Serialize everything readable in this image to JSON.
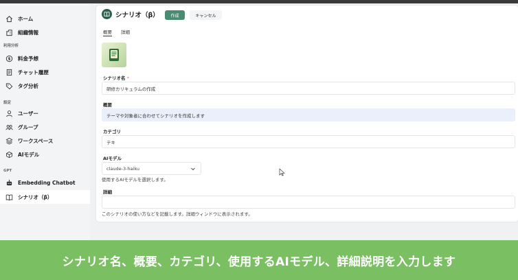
{
  "sidebar": {
    "top_items": [
      {
        "label": "ホーム",
        "icon": "home-icon"
      },
      {
        "label": "組織情報",
        "icon": "building-icon"
      }
    ],
    "section_usage": "利用分析",
    "usage_items": [
      {
        "label": "料金予想",
        "icon": "dollar-icon"
      },
      {
        "label": "チャット履歴",
        "icon": "history-icon"
      },
      {
        "label": "タグ分析",
        "icon": "tag-icon"
      }
    ],
    "section_settings": "設定",
    "settings_items": [
      {
        "label": "ユーザー",
        "icon": "user-icon"
      },
      {
        "label": "グループ",
        "icon": "group-icon"
      },
      {
        "label": "ワークスペース",
        "icon": "workspace-icon"
      },
      {
        "label": "AIモデル",
        "icon": "cube-icon"
      }
    ],
    "section_gpt": "GPT",
    "gpt_items": [
      {
        "label": "Embedding Chatbot",
        "icon": "robot-icon"
      },
      {
        "label": "シナリオ（β）",
        "icon": "book-icon",
        "active": true
      }
    ]
  },
  "header": {
    "title": "シナリオ（β）",
    "create_label": "作成",
    "cancel_label": "キャンセル"
  },
  "tabs": [
    "概要",
    "詳細"
  ],
  "form": {
    "name_label": "シナリオ名",
    "name_required": "*",
    "name_value": "研修カリキュラムの作成",
    "summary_label": "概要",
    "summary_value": "テーマや対象者に合わせてシナリオを作成します",
    "category_label": "カテゴリ",
    "category_value": "テキ",
    "model_label": "AIモデル",
    "model_value": "claude-3-haiku",
    "model_help": "使用するAIモデルを選択します。",
    "detail_label": "詳細",
    "detail_value": "",
    "detail_help": "このシナリオの使い方などを記載します。詳細ウィンドウに表示されます。"
  },
  "banner": {
    "text": "シナリオ名、概要、カテゴリ、使用するAIモデル、詳細説明を入力します"
  },
  "colors": {
    "accent": "#4a8b74",
    "banner": "#7bbf63",
    "title_icon": "#2f5d4c"
  }
}
